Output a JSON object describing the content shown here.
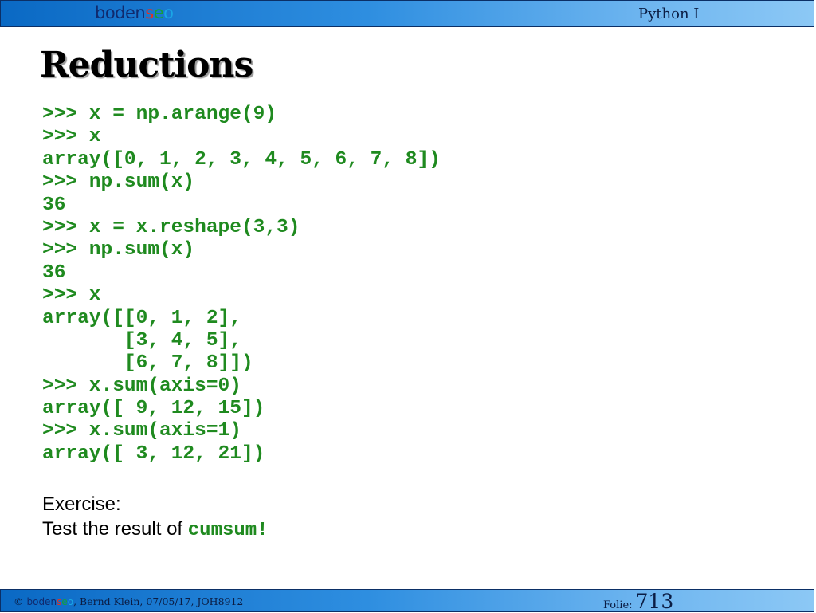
{
  "header": {
    "logo": {
      "part1": "boden",
      "s": "s",
      "e": "e",
      "o": "o"
    },
    "course": "Python I"
  },
  "title": "Reductions",
  "code_lines": [
    ">>> x = np.arange(9)",
    ">>> x",
    "array([0, 1, 2, 3, 4, 5, 6, 7, 8])",
    ">>> np.sum(x)",
    "36",
    ">>> x = x.reshape(3,3)",
    ">>> np.sum(x)",
    "36",
    ">>> x",
    "array([[0, 1, 2],",
    "       [3, 4, 5],",
    "       [6, 7, 8]])",
    ">>> x.sum(axis=0)",
    "array([ 9, 12, 15])",
    ">>> x.sum(axis=1)",
    "array([ 3, 12, 21])"
  ],
  "exercise": {
    "heading": "Exercise:",
    "text": "Test the result of ",
    "code": "cumsum!"
  },
  "footer": {
    "copyright": "© ",
    "logo": {
      "part1": "boden",
      "s": "s",
      "e": "e",
      "o": "o"
    },
    "author": ", Bernd Klein, 07/05/17, JOH8912",
    "folie_label": "Folie:",
    "folie_number": "713"
  },
  "colors": {
    "code_green": "#1f8a1f",
    "bar_blue": "#2e8ee0",
    "logo_red": "#e6301e",
    "logo_green": "#16a03a",
    "logo_cyan": "#1aa7e6"
  }
}
